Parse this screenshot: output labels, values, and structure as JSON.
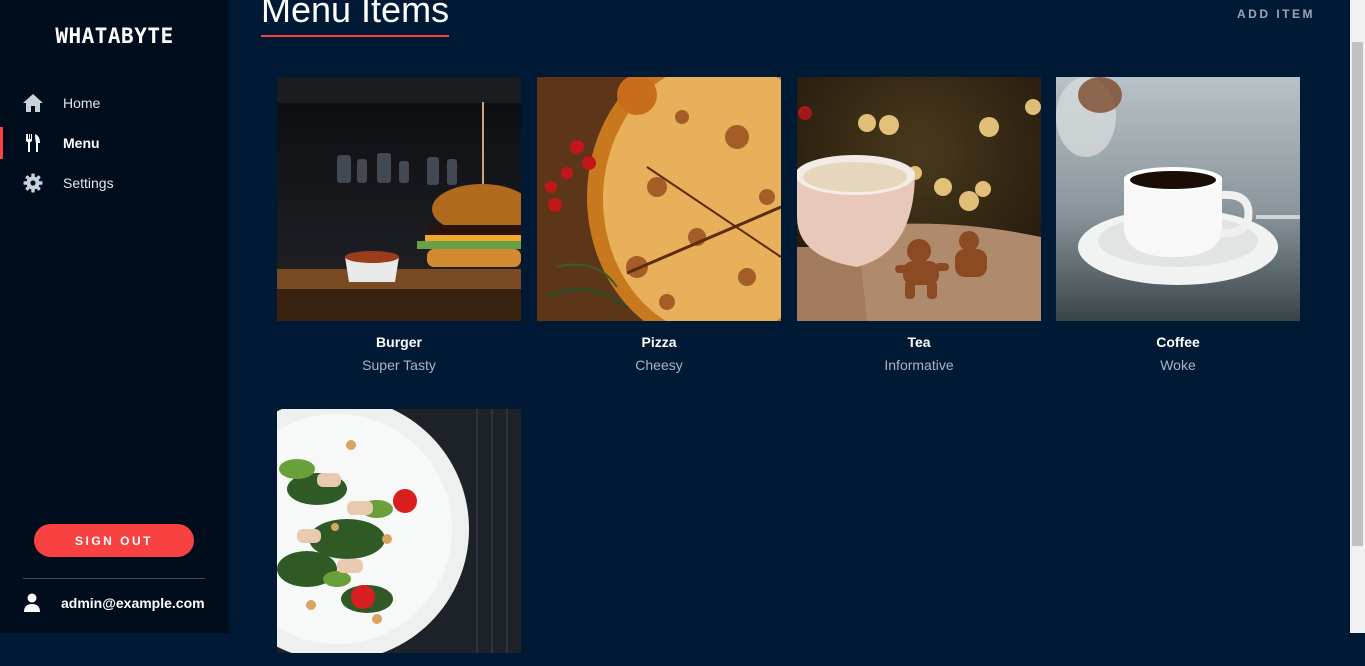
{
  "sidebar": {
    "brand": "WHATABYTE",
    "nav": [
      {
        "label": "Home",
        "icon": "home-icon",
        "active": false
      },
      {
        "label": "Menu",
        "icon": "utensils-icon",
        "active": true
      },
      {
        "label": "Settings",
        "icon": "gear-icon",
        "active": false
      }
    ],
    "sign_out_label": "SIGN OUT",
    "user_email": "admin@example.com"
  },
  "header": {
    "title": "Menu Items",
    "add_item_label": "ADD ITEM"
  },
  "menu_items": [
    {
      "name": "Burger",
      "description": "Super Tasty",
      "image": "burger-photo"
    },
    {
      "name": "Pizza",
      "description": "Cheesy",
      "image": "pizza-photo"
    },
    {
      "name": "Tea",
      "description": "Informative",
      "image": "tea-photo"
    },
    {
      "name": "Coffee",
      "description": "Woke",
      "image": "coffee-photo"
    },
    {
      "name": "",
      "description": "",
      "image": "salad-photo"
    }
  ],
  "colors": {
    "accent": "#f84141",
    "background": "#001a35",
    "sidebar": "#000d1d"
  }
}
